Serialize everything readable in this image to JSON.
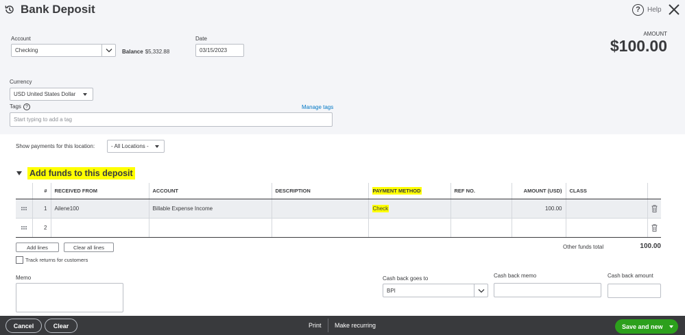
{
  "header": {
    "title": "Bank Deposit",
    "help_label": "Help",
    "icons": {
      "history": "history-icon",
      "help": "question-icon",
      "close": "close-icon"
    }
  },
  "account": {
    "label": "Account",
    "value": "Checking",
    "balance_label": "Balance",
    "balance_value": "$5,332.88"
  },
  "date": {
    "label": "Date",
    "value": "03/15/2023"
  },
  "amount": {
    "label": "AMOUNT",
    "value": "$100.00"
  },
  "currency": {
    "label": "Currency",
    "value": "USD United States Dollar"
  },
  "tags": {
    "label": "Tags",
    "placeholder": "Start typing to add a tag",
    "manage_link": "Manage tags"
  },
  "location_filter": {
    "label": "Show payments for this location:",
    "value": "- All Locations -"
  },
  "funds_section": {
    "title": "Add funds to this deposit",
    "columns": [
      "",
      "#",
      "RECEIVED FROM",
      "ACCOUNT",
      "DESCRIPTION",
      "PAYMENT METHOD",
      "REF NO.",
      "AMOUNT (USD)",
      "CLASS",
      ""
    ],
    "rows": [
      {
        "num": "1",
        "received_from": "Ailene100",
        "account": "Billable Expense Income",
        "description": "",
        "payment_method": "Check",
        "ref_no": "",
        "amount": "100.00",
        "class": ""
      },
      {
        "num": "2",
        "received_from": "",
        "account": "",
        "description": "",
        "payment_method": "",
        "ref_no": "",
        "amount": "",
        "class": ""
      }
    ],
    "add_lines_label": "Add lines",
    "clear_lines_label": "Clear all lines",
    "other_total_label": "Other funds total",
    "other_total_value": "100.00",
    "track_returns_label": "Track returns for customers",
    "highlight_color": "#ffff00"
  },
  "memo": {
    "label": "Memo"
  },
  "cash_back": {
    "goes_to_label": "Cash back goes to",
    "goes_to_value": "BPI",
    "memo_label": "Cash back memo",
    "amount_label": "Cash back amount"
  },
  "footer": {
    "cancel_label": "Cancel",
    "clear_label": "Clear",
    "print_label": "Print",
    "recurring_label": "Make recurring",
    "save_label": "Save and new",
    "primary_color": "#2ca01c",
    "bar_color": "#393a3d"
  }
}
